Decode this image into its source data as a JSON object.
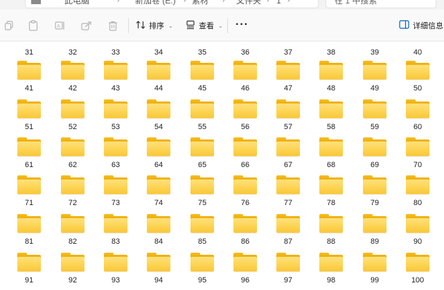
{
  "address": {
    "crumbs": [
      "此电脑",
      "新加卷 (E:)",
      "素材",
      "文件夹",
      "1"
    ],
    "search_placeholder": "在 1 中搜索"
  },
  "toolbar": {
    "icons": [
      "copy-icon",
      "paste-icon",
      "rename-icon",
      "share-icon",
      "delete-icon"
    ],
    "sort_label": "排序",
    "view_label": "查看",
    "more_label": "···",
    "details_label": "详细信息"
  },
  "folders": [
    [
      "31",
      "32",
      "33",
      "34",
      "35",
      "36",
      "37",
      "38",
      "39",
      "40"
    ],
    [
      "41",
      "42",
      "43",
      "44",
      "45",
      "46",
      "47",
      "48",
      "49",
      "50"
    ],
    [
      "51",
      "52",
      "53",
      "54",
      "55",
      "56",
      "57",
      "58",
      "59",
      "60"
    ],
    [
      "61",
      "62",
      "63",
      "64",
      "65",
      "66",
      "67",
      "68",
      "69",
      "70"
    ],
    [
      "71",
      "72",
      "73",
      "74",
      "75",
      "76",
      "77",
      "78",
      "79",
      "80"
    ],
    [
      "81",
      "82",
      "83",
      "84",
      "85",
      "86",
      "87",
      "88",
      "89",
      "90"
    ],
    [
      "91",
      "92",
      "93",
      "94",
      "95",
      "96",
      "97",
      "98",
      "99",
      "100"
    ]
  ],
  "colors": {
    "folder_front": "#fdd452",
    "folder_back": "#f0b20f",
    "details_accent": "#005fb8"
  }
}
